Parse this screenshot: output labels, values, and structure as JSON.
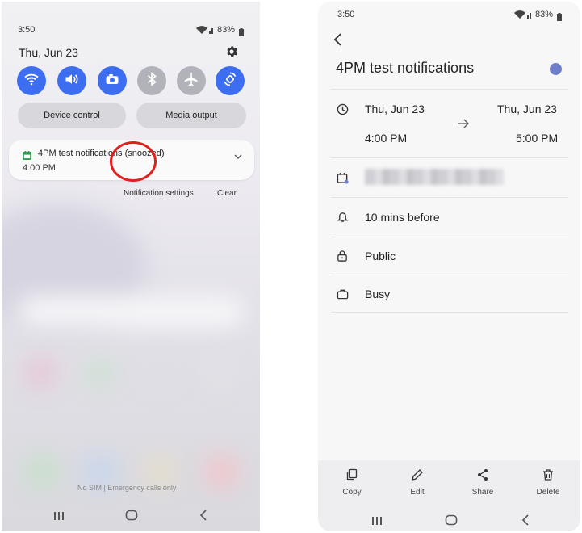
{
  "left_phone": {
    "status": {
      "time": "3:50",
      "battery": "83%"
    },
    "date": "Thu, Jun 23",
    "quick_settings": [
      {
        "icon": "wifi-icon",
        "on": true
      },
      {
        "icon": "sound-icon",
        "on": true
      },
      {
        "icon": "camera-icon",
        "on": true
      },
      {
        "icon": "bluetooth-icon",
        "on": false
      },
      {
        "icon": "airplane-icon",
        "on": false
      },
      {
        "icon": "auto-rotate-icon",
        "on": true
      }
    ],
    "device_control": "Device control",
    "media_output": "Media output",
    "notification": {
      "title": "4PM test notifications (snoozed)",
      "time": "4:00 PM"
    },
    "notification_settings": "Notification settings",
    "clear": "Clear",
    "footer": "No SIM | Emergency calls only"
  },
  "right_phone": {
    "status": {
      "time": "3:50",
      "battery": "83%"
    },
    "event_title": "4PM test notifications",
    "event_color": "#6f7fc9",
    "start_date": "Thu, Jun 23",
    "start_time": "4:00 PM",
    "end_date": "Thu, Jun 23",
    "end_time": "5:00 PM",
    "reminder": "10 mins before",
    "visibility": "Public",
    "availability": "Busy",
    "actions": {
      "copy": "Copy",
      "edit": "Edit",
      "share": "Share",
      "delete": "Delete"
    }
  }
}
